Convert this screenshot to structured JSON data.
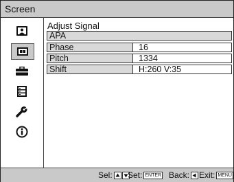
{
  "window": {
    "title": "Screen"
  },
  "sidebar": {
    "items": [
      {
        "icon": "picture-icon",
        "selected": false
      },
      {
        "icon": "screen-icon",
        "selected": true
      },
      {
        "icon": "setup-toolbox-icon",
        "selected": false
      },
      {
        "icon": "menu-list-icon",
        "selected": false
      },
      {
        "icon": "wrench-icon",
        "selected": false
      },
      {
        "icon": "info-icon",
        "selected": false
      }
    ]
  },
  "main": {
    "heading": "Adjust Signal",
    "apa_label": "APA",
    "rows": [
      {
        "label": "Phase",
        "value": "16"
      },
      {
        "label": "Pitch",
        "value": "1334"
      },
      {
        "label": "Shift",
        "value": "H:260 V:35"
      }
    ]
  },
  "footer": {
    "sel_label": "Sel:",
    "set_label": "Set:",
    "set_key": "ENTER",
    "back_label": "Back:",
    "exit_label": "Exit:",
    "exit_key": "MENU"
  }
}
